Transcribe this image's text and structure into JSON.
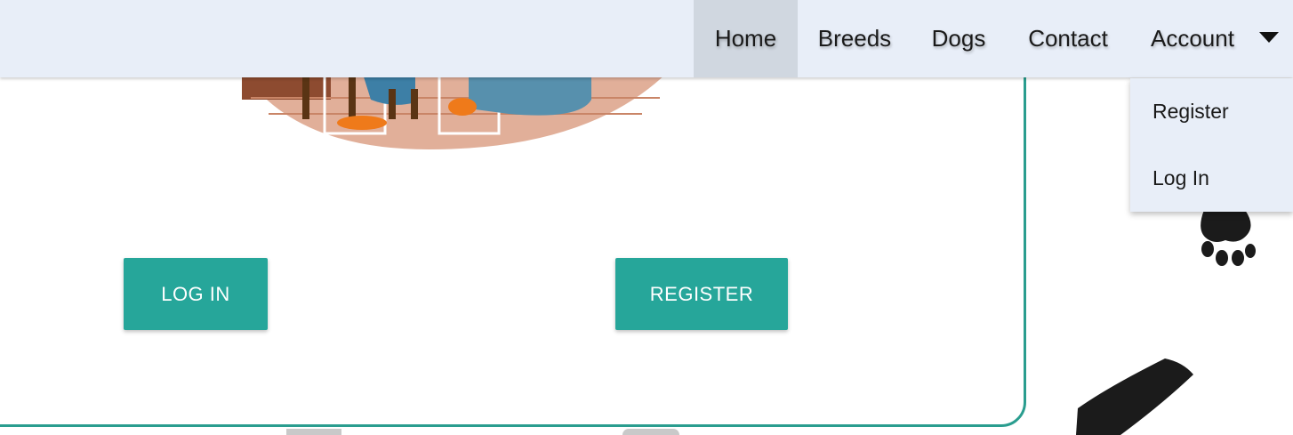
{
  "nav": {
    "items": [
      {
        "label": "Home",
        "active": true
      },
      {
        "label": "Breeds"
      },
      {
        "label": "Dogs"
      },
      {
        "label": "Contact"
      },
      {
        "label": "Account",
        "icon": "caret-down-icon"
      }
    ]
  },
  "account_menu": {
    "items": [
      {
        "label": "Register"
      },
      {
        "label": "Log In"
      }
    ]
  },
  "main": {
    "login_button": "LOG IN",
    "register_button": "REGISTER"
  },
  "colors": {
    "accent": "#26a69a",
    "card_border": "#2a9d8f",
    "navbar_bg": "#e8eef8",
    "nav_active_bg": "#d0d7e0"
  },
  "decor": {
    "illustration": "dogs-room-illustration",
    "side_icons": [
      "paw-print-icon",
      "dog-leash-icon"
    ]
  }
}
